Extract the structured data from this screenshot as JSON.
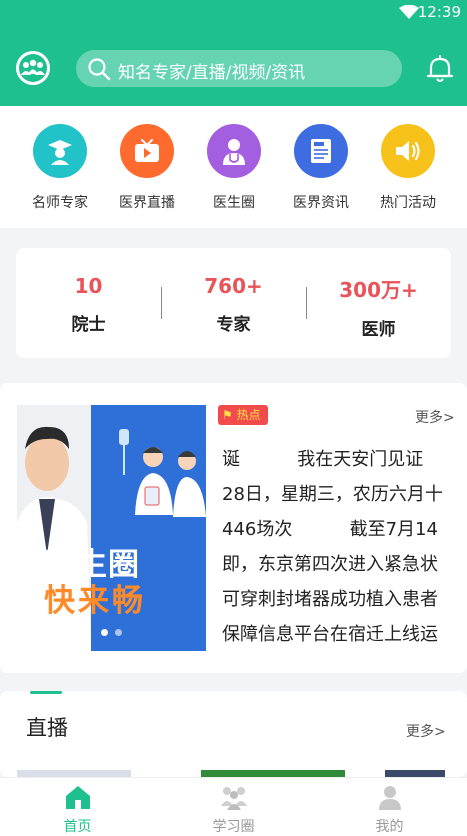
{
  "status_bar": {
    "time": "12:39"
  },
  "search": {
    "placeholder": "知名专家/直播/视频/资讯"
  },
  "quick_nav": [
    {
      "label": "名师专家",
      "icon": "doctor-cap-icon",
      "color": "#22c3c8"
    },
    {
      "label": "医界直播",
      "icon": "tv-play-icon",
      "color": "#ff6a2f"
    },
    {
      "label": "医生圈",
      "icon": "doctor-icon",
      "color": "#a45ee0"
    },
    {
      "label": "医界资讯",
      "icon": "news-doc-icon",
      "color": "#3d6de0"
    },
    {
      "label": "热门活动",
      "icon": "speaker-icon",
      "color": "#f6c21a"
    }
  ],
  "stats": [
    {
      "value": "10",
      "label": "院士"
    },
    {
      "value": "760+",
      "label": "专家"
    },
    {
      "value": "300万+",
      "label": "医师"
    }
  ],
  "banner": {
    "title": "医生圈",
    "subtitle": "快来畅"
  },
  "news": {
    "badge": "热点",
    "more": "更多>",
    "lines": [
      "诞          我在天安门见证",
      "28日，星期三，农历六月十",
      "446场次          截至7月14",
      "即，东京第四次进入紧急状",
      "可穿刺封堵器成功植入患者",
      "保障信息平台在宿迁上线运"
    ]
  },
  "live": {
    "title": "直播",
    "more": "更多>"
  },
  "tabs": [
    {
      "label": "首页",
      "icon": "home-icon",
      "active": true
    },
    {
      "label": "学习圈",
      "icon": "study-group-icon",
      "active": false
    },
    {
      "label": "我的",
      "icon": "profile-icon",
      "active": false
    }
  ],
  "colors": {
    "brand": "#1ec08f",
    "accent_red": "#e8545a"
  }
}
